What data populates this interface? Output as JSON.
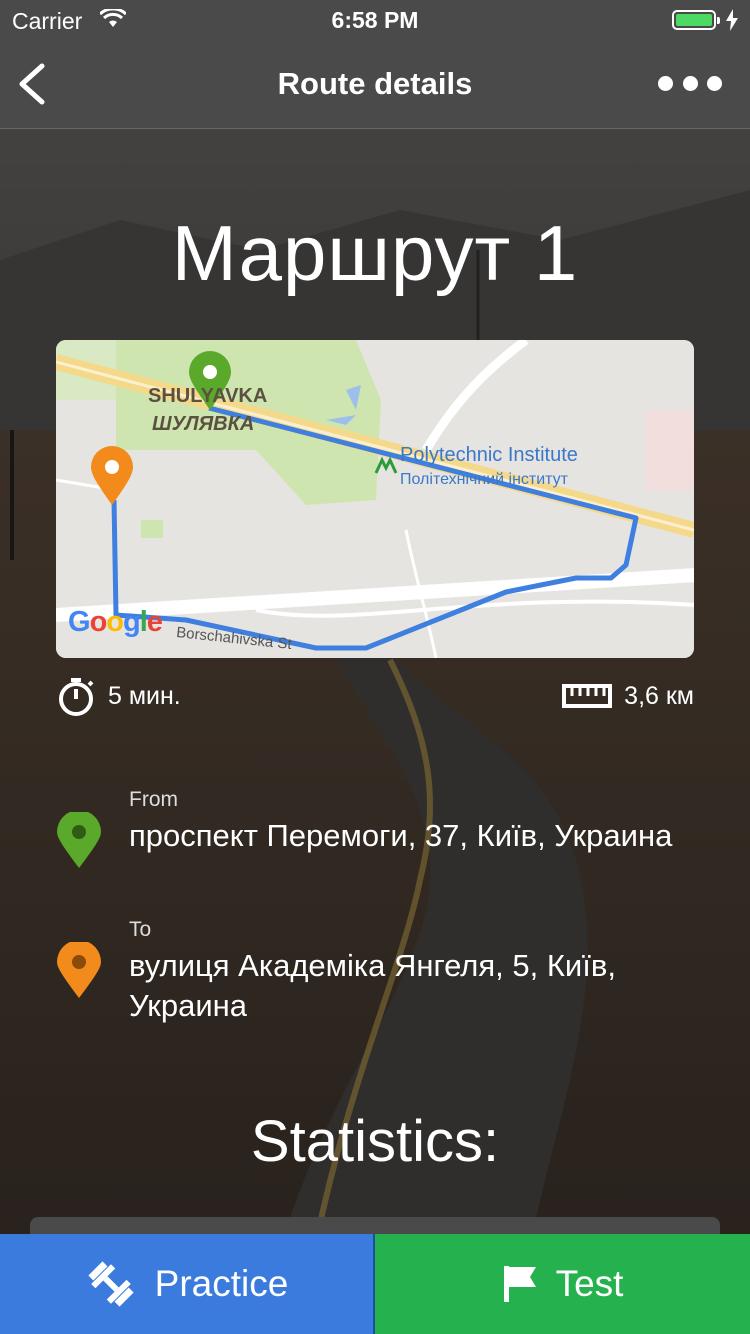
{
  "status_bar": {
    "carrier": "Carrier",
    "time": "6:58 PM",
    "battery_color": "#4cd964"
  },
  "nav": {
    "title": "Route details",
    "back_icon": "chevron-left-icon",
    "more_icon": "more-dots-icon"
  },
  "route": {
    "name": "Маршрут 1",
    "duration": "5 мин.",
    "distance": "3,6 км"
  },
  "map": {
    "district_en": "SHULYAVKA",
    "district_ua": "ШУЛЯВКА",
    "station_en": "Polytechnic Institute",
    "station_ua": "Політехнічний інститут",
    "street": "Borschahivska St",
    "logo": "Google",
    "route_color": "#3f7fe0",
    "start_pin_color": "#5aa92a",
    "end_pin_color": "#f28a1c"
  },
  "from": {
    "label": "From",
    "address": "проспект Перемоги, 37, Київ, Украина"
  },
  "to": {
    "label": "To",
    "address": "вулиця Академіка Янгеля, 5, Київ, Украина"
  },
  "statistics": {
    "title": "Statistics:"
  },
  "buttons": {
    "practice": {
      "label": "Practice",
      "icon": "dumbbell-icon",
      "color": "#3b7bdd"
    },
    "test": {
      "label": "Test",
      "icon": "flag-icon",
      "color": "#26b14f"
    }
  }
}
